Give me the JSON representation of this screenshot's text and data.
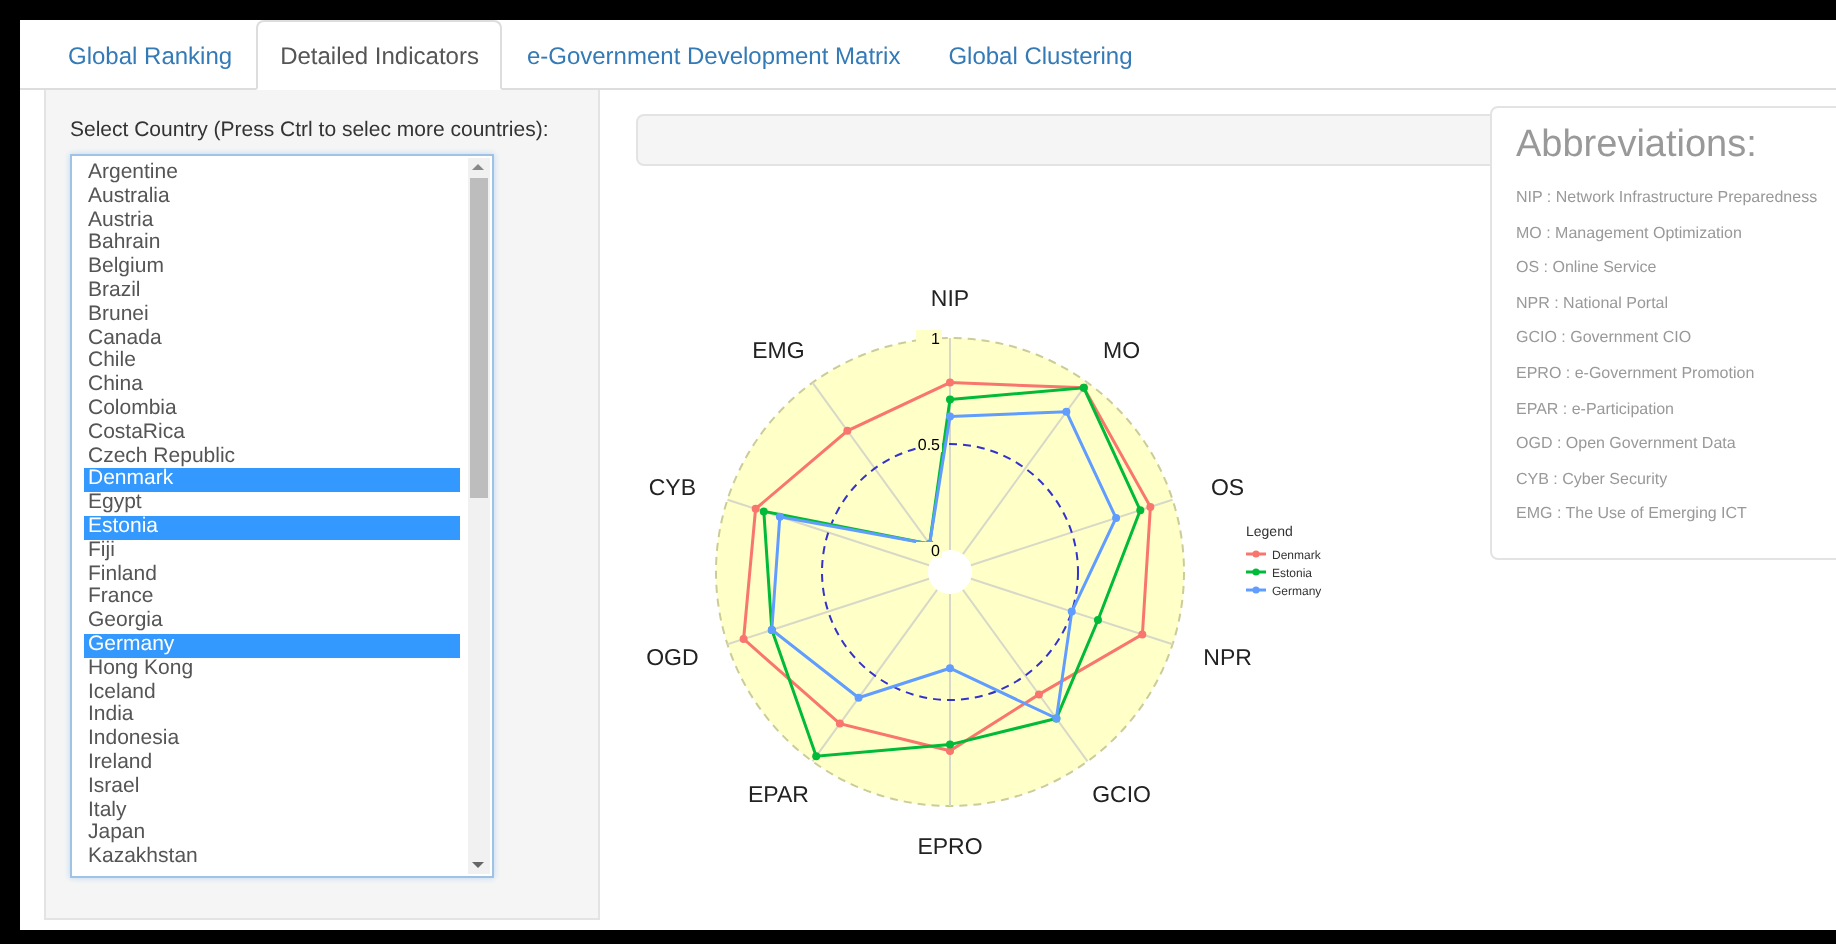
{
  "tabs": [
    {
      "label": "Global Ranking",
      "selected": false
    },
    {
      "label": "Detailed Indicators",
      "selected": true
    },
    {
      "label": "e-Government Development Matrix",
      "selected": false
    },
    {
      "label": "Global Clustering",
      "selected": false
    }
  ],
  "country_select": {
    "label": "Select Country (Press Ctrl to selec more countries):",
    "options": [
      {
        "label": "Argentine",
        "selected": false
      },
      {
        "label": "Australia",
        "selected": false
      },
      {
        "label": "Austria",
        "selected": false
      },
      {
        "label": "Bahrain",
        "selected": false
      },
      {
        "label": "Belgium",
        "selected": false
      },
      {
        "label": "Brazil",
        "selected": false
      },
      {
        "label": "Brunei",
        "selected": false
      },
      {
        "label": "Canada",
        "selected": false
      },
      {
        "label": "Chile",
        "selected": false
      },
      {
        "label": "China",
        "selected": false
      },
      {
        "label": "Colombia",
        "selected": false
      },
      {
        "label": "CostaRica",
        "selected": false
      },
      {
        "label": "Czech Republic",
        "selected": false
      },
      {
        "label": "Denmark",
        "selected": true
      },
      {
        "label": "Egypt",
        "selected": false
      },
      {
        "label": "Estonia",
        "selected": true
      },
      {
        "label": "Fiji",
        "selected": false
      },
      {
        "label": "Finland",
        "selected": false
      },
      {
        "label": "France",
        "selected": false
      },
      {
        "label": "Georgia",
        "selected": false
      },
      {
        "label": "Germany",
        "selected": true
      },
      {
        "label": "Hong Kong",
        "selected": false
      },
      {
        "label": "Iceland",
        "selected": false
      },
      {
        "label": "India",
        "selected": false
      },
      {
        "label": "Indonesia",
        "selected": false
      },
      {
        "label": "Ireland",
        "selected": false
      },
      {
        "label": "Israel",
        "selected": false
      },
      {
        "label": "Italy",
        "selected": false
      },
      {
        "label": "Japan",
        "selected": false
      },
      {
        "label": "Kazakhstan",
        "selected": false
      }
    ]
  },
  "radar": {
    "axes": [
      "NIP",
      "MO",
      "OS",
      "NPR",
      "GCIO",
      "EPRO",
      "EPAR",
      "OGD",
      "CYB",
      "EMG"
    ],
    "tick_labels": [
      "1",
      "0.5",
      "0"
    ],
    "legend": {
      "title": "Legend",
      "items": [
        {
          "name": "Denmark",
          "color": "#f8766d"
        },
        {
          "name": "Estonia",
          "color": "#00ba38"
        },
        {
          "name": "Germany",
          "color": "#619cff"
        }
      ]
    }
  },
  "abbreviations": {
    "title": "Abbreviations:",
    "items": [
      "NIP : Network Infrastructure Preparedness",
      "MO : Management Optimization",
      "OS : Online Service",
      "NPR : National Portal",
      "GCIO : Government CIO",
      "EPRO : e-Government Promotion",
      "EPAR : e-Participation",
      "OGD : Open Government Data",
      "CYB : Cyber Security",
      "EMG : The Use of Emerging ICT"
    ]
  }
}
